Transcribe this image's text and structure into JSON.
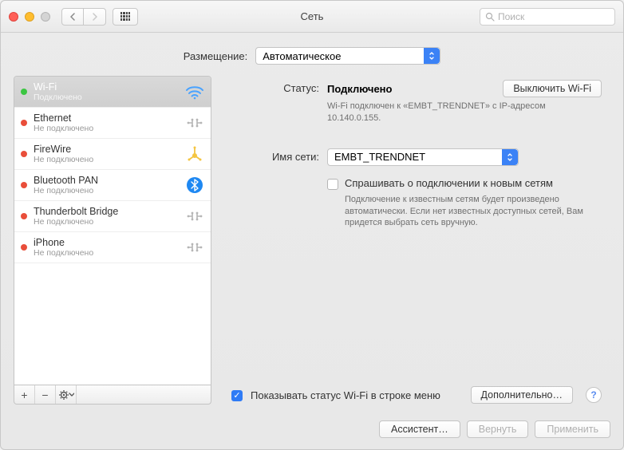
{
  "window": {
    "title": "Сеть",
    "search_placeholder": "Поиск"
  },
  "location": {
    "label": "Размещение:",
    "value": "Автоматическое"
  },
  "sidebar": {
    "items": [
      {
        "name": "Wi-Fi",
        "status": "Подключено",
        "dot": "green",
        "icon": "wifi"
      },
      {
        "name": "Ethernet",
        "status": "Не подключено",
        "dot": "red",
        "icon": "ethernet"
      },
      {
        "name": "FireWire",
        "status": "Не подключено",
        "dot": "red",
        "icon": "firewire"
      },
      {
        "name": "Bluetooth PAN",
        "status": "Не подключено",
        "dot": "red",
        "icon": "bluetooth"
      },
      {
        "name": "Thunderbolt Bridge",
        "status": "Не подключено",
        "dot": "red",
        "icon": "thunderbolt"
      },
      {
        "name": "iPhone",
        "status": "Не подключено",
        "dot": "red",
        "icon": "iphone"
      }
    ]
  },
  "main": {
    "status_label": "Статус:",
    "status_value": "Подключено",
    "toggle_button": "Выключить Wi-Fi",
    "status_desc": "Wi-Fi подключен к «EMBT_TRENDNET» с IP-адресом 10.140.0.155.",
    "network_label": "Имя сети:",
    "network_value": "EMBT_TRENDNET",
    "ask_checkbox_label": "Спрашивать о подключении к новым сетям",
    "ask_desc": "Подключение к известным сетям будет произведено автоматически. Если нет известных доступных сетей, Вам придется выбрать сеть вручную.",
    "show_status_label": "Показывать статус Wi-Fi в строке меню",
    "advanced_button": "Дополнительно…"
  },
  "footer": {
    "assistant": "Ассистент…",
    "revert": "Вернуть",
    "apply": "Применить"
  }
}
